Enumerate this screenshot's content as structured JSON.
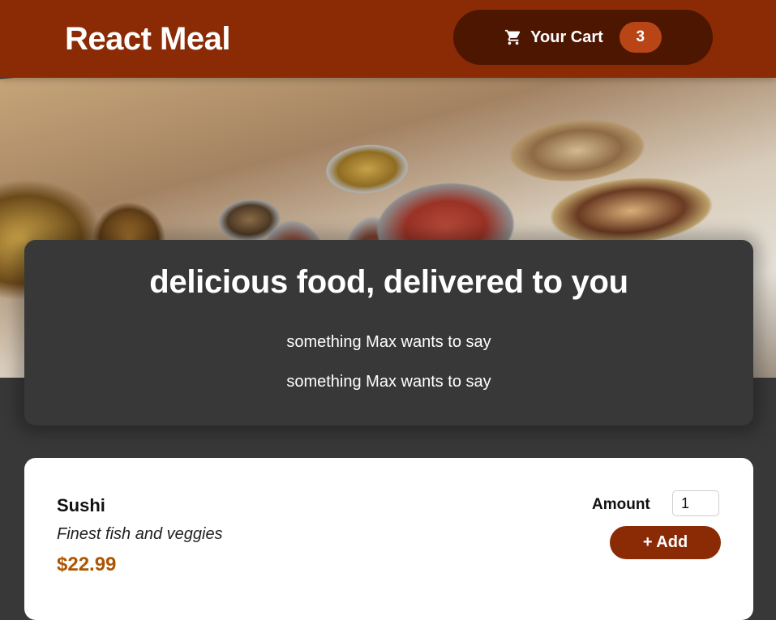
{
  "header": {
    "title": "React Meal",
    "cart": {
      "label": "Your Cart",
      "count": "3",
      "icon": "cart-icon"
    }
  },
  "hero": {
    "image": "buffet-table-food-photo"
  },
  "summary": {
    "title": "delicious food, delivered to you",
    "paragraphs": [
      "something Max wants to say",
      "something Max wants to say"
    ]
  },
  "meals": [
    {
      "name": "Sushi",
      "description": "Finest fish and veggies",
      "price": "$22.99",
      "amount_label": "Amount",
      "amount_value": "1",
      "add_label": "+ Add"
    }
  ],
  "colors": {
    "header_bg": "#8a2b06",
    "cart_button_bg": "#4d1601",
    "badge_bg": "#b94517",
    "page_bg": "#383838",
    "price": "#ad5502"
  }
}
